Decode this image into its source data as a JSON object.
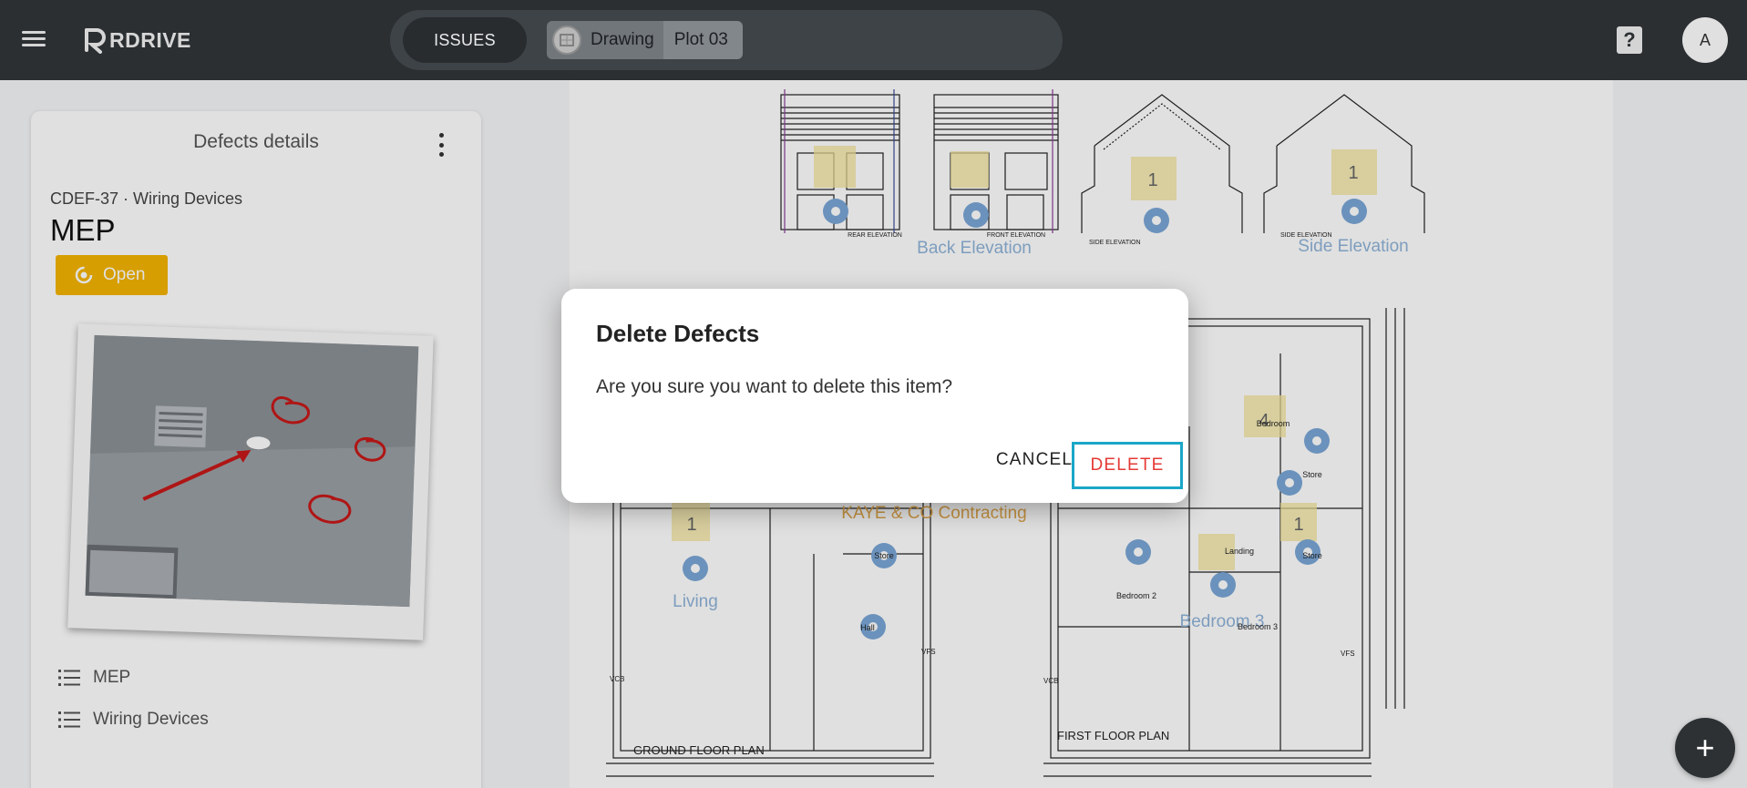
{
  "header": {
    "logo_text": "RDRIVE",
    "issues_label": "ISSUES",
    "breadcrumb_drawing": "Drawing",
    "breadcrumb_plot": "Plot 03",
    "help_label": "?",
    "avatar_initial": "A"
  },
  "panel": {
    "title": "Defects details",
    "code": "CDEF-37 · Wiring Devices",
    "name": "MEP",
    "status": "Open",
    "status_color": "#f4b400",
    "meta": [
      {
        "icon": "list-icon",
        "label": "MEP"
      },
      {
        "icon": "list-icon",
        "label": "Wiring Devices"
      }
    ]
  },
  "drawing": {
    "elevation_labels": [
      "Back Elevation",
      "Side Elevation"
    ],
    "room_labels": [
      "Living",
      "Bedroom 3"
    ],
    "contractor_label": "KAYE & CO Contracting",
    "plan_titles": [
      "GROUND FLOOR PLAN",
      "FIRST FLOOR PLAN"
    ],
    "small_labels": [
      "REAR ELEVATION",
      "FRONT ELEVATION",
      "SIDE ELEVATION",
      "SIDE ELEVATION",
      "Bedroom 2",
      "Bedroom 3",
      "Landing",
      "Store",
      "Hall",
      "Store",
      "Store",
      "Bedroom",
      "VCB",
      "VFS",
      "VFS",
      "VCB"
    ],
    "marker_numbers": [
      "1",
      "1",
      "1",
      "4",
      "1"
    ]
  },
  "dialog": {
    "title": "Delete Defects",
    "message": "Are you sure you want to delete this item?",
    "cancel_label": "CANCEL",
    "delete_label": "DELETE",
    "delete_color": "#e53935",
    "focus_color": "#1aa7c8"
  },
  "fab": {
    "label": "+"
  }
}
